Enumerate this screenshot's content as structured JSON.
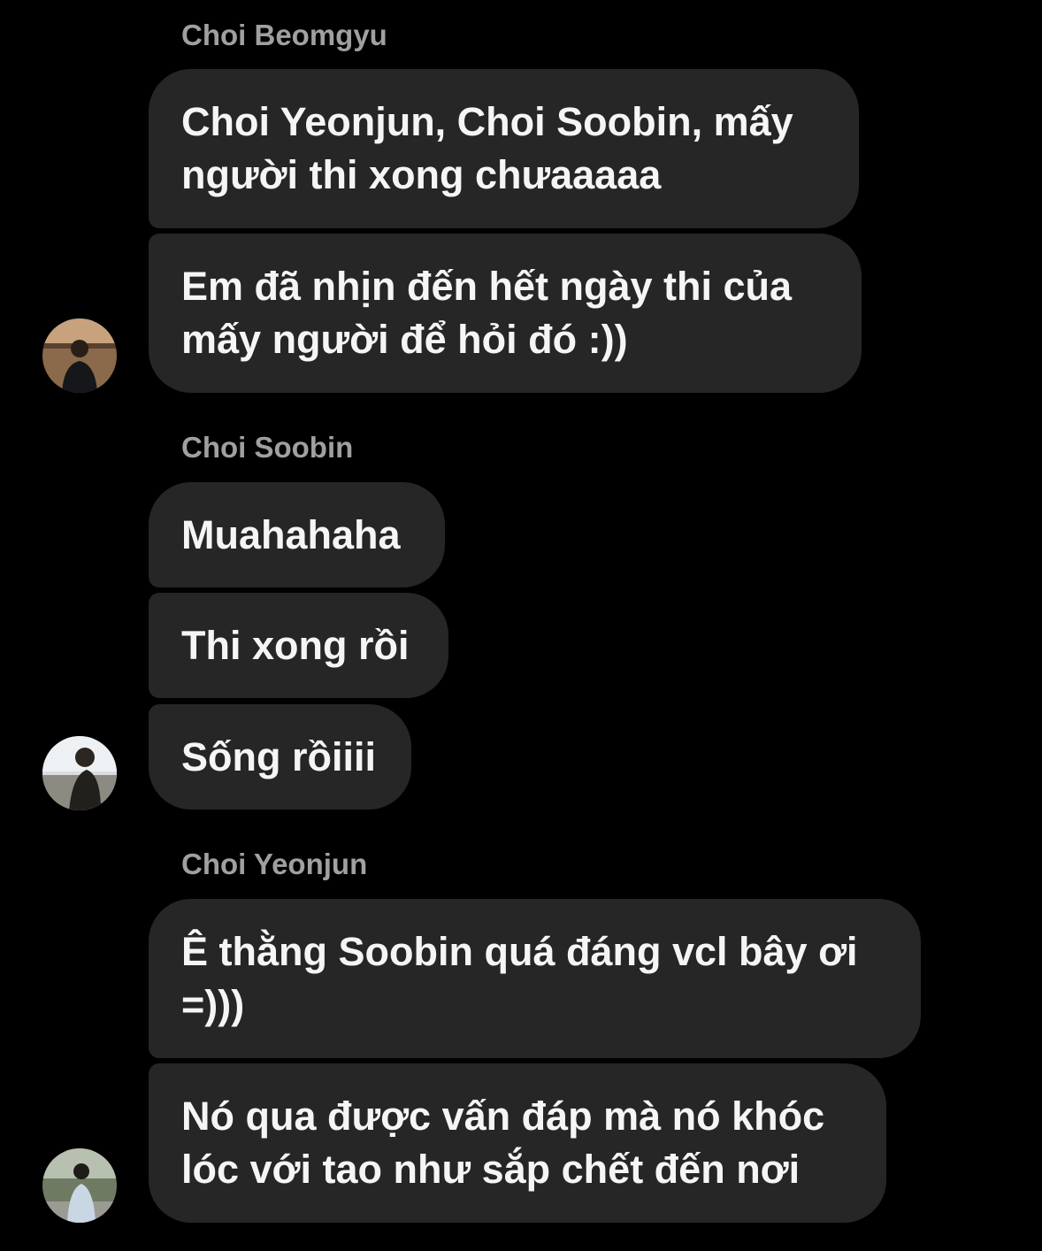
{
  "chat": {
    "groups": [
      {
        "sender": "Choi Beomgyu",
        "avatar": "beomgyu-avatar",
        "messages": [
          "Choi Yeonjun, Choi Soobin, mấy\nngười thi xong chưaaaaa",
          "Em đã nhịn đến hết ngày thi của\nmấy người để hỏi đó :))"
        ]
      },
      {
        "sender": "Choi Soobin",
        "avatar": "soobin-avatar",
        "messages": [
          "Muahahaha",
          "Thi xong rồi",
          "Sống rồiiii"
        ]
      },
      {
        "sender": "Choi Yeonjun",
        "avatar": "yeonjun-avatar",
        "messages": [
          "Ê thằng Soobin quá đáng vcl bây ơi\n=)))",
          "Nó qua được vấn đáp mà nó khóc\nlóc với tao như sắp chết đến nơi"
        ]
      }
    ]
  },
  "colors": {
    "background": "#000000",
    "bubble": "#262626",
    "sender_name": "#a0a0a0",
    "message_text": "#f5f5f5"
  }
}
